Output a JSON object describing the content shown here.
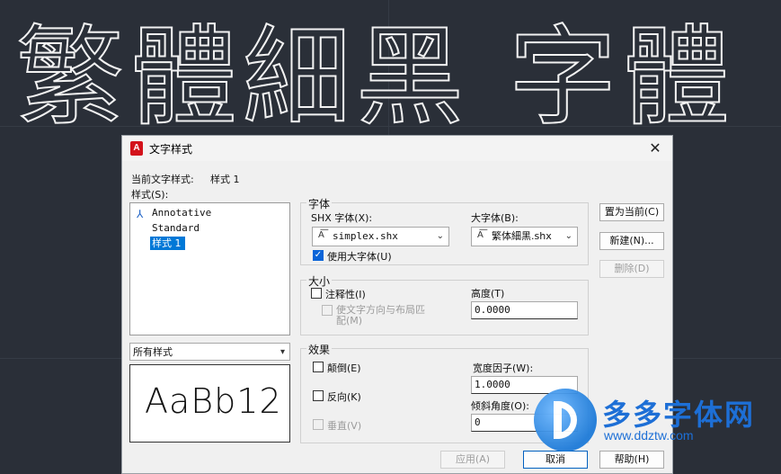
{
  "background": {
    "cad_text": "繁體細黑 字體"
  },
  "dialog": {
    "title": "文字样式",
    "app_icon": "A",
    "close_glyph": "✕",
    "current_style_label": "当前文字样式:",
    "current_style_value": "样式 1",
    "styles_label": "样式(S):",
    "styles": [
      {
        "name": "Annotative",
        "annotative": true
      },
      {
        "name": "Standard",
        "annotative": false
      },
      {
        "name": "样式 1",
        "annotative": false,
        "selected": true
      }
    ],
    "filter_select": "所有样式",
    "preview_text": "AaBb12",
    "font_group": {
      "title": "字体",
      "shx_font_label": "SHX 字体(X):",
      "shx_font_value": "simplex.shx",
      "bigfont_label": "大字体(B):",
      "bigfont_value": "繁体細黑.shx",
      "use_bigfont_label": "使用大字体(U)",
      "use_bigfont_checked": true
    },
    "size_group": {
      "title": "大小",
      "annotative_label": "注释性(I)",
      "match_orientation_label": "使文字方向与布局匹配(M)",
      "height_label": "高度(T)",
      "height_value": "0.0000"
    },
    "effects_group": {
      "title": "效果",
      "upside_down_label": "颠倒(E)",
      "backwards_label": "反向(K)",
      "vertical_label": "垂直(V)",
      "width_factor_label": "宽度因子(W):",
      "width_factor_value": "1.0000",
      "oblique_label": "倾斜角度(O):",
      "oblique_value": "0"
    },
    "buttons": {
      "set_current": "置为当前(C)",
      "new": "新建(N)...",
      "delete": "删除(D)",
      "apply": "应用(A)",
      "cancel": "取消",
      "help": "帮助(H)"
    },
    "icons": {
      "dropdown": "chevron-down-icon",
      "annotative": "annotative-icon",
      "font": "font-icon",
      "close": "close-icon"
    }
  },
  "watermark": {
    "title": "多多字体网",
    "url": "www.ddztw.com"
  }
}
